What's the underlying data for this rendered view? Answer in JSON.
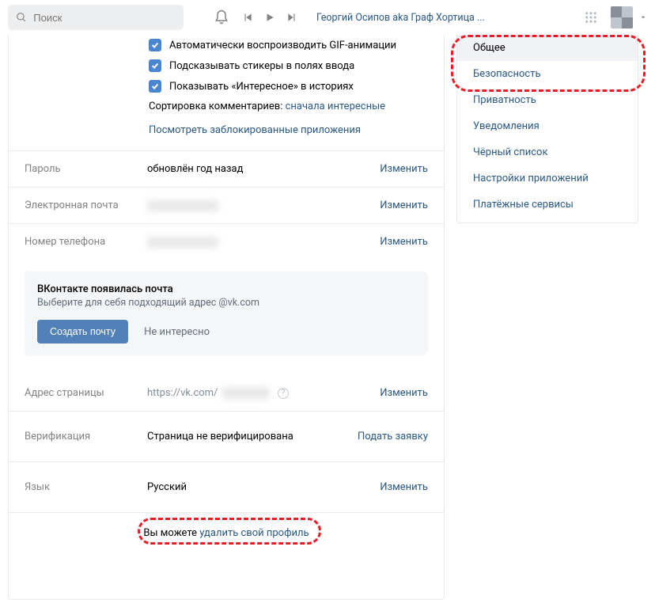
{
  "header": {
    "search_placeholder": "Поиск",
    "track": "Георгий Осипов aka Граф Хортица ..."
  },
  "checkboxes": {
    "gif": "Автоматически воспроизводить GIF-анимации",
    "stickers": "Подсказывать стикеры в полях ввода",
    "interesting": "Показывать «Интересное» в историях"
  },
  "sort_label": "Сортировка комментариев: ",
  "sort_value": "сначала интересные",
  "blocked_apps": "Посмотреть заблокированные приложения",
  "rows": {
    "password_label": "Пароль",
    "password_value": "обновлён год назад",
    "email_label": "Электронная почта",
    "phone_label": "Номер телефона",
    "url_label": "Адрес страницы",
    "url_value": "https://vk.com/",
    "verify_label": "Верификация",
    "verify_value": "Страница не верифицирована",
    "verify_action": "Подать заявку",
    "lang_label": "Язык",
    "lang_value": "Русский",
    "change": "Изменить"
  },
  "promo": {
    "title": "ВКонтакте появилась почта",
    "subtitle": "Выберите для себя подходящий адрес @vk.com",
    "create": "Создать почту",
    "dismiss": "Не интересно"
  },
  "footer": {
    "prefix": "Вы можете ",
    "link": "удалить свой профиль"
  },
  "sidebar": {
    "items": [
      "Общее",
      "Безопасность",
      "Приватность",
      "Уведомления",
      "Чёрный список",
      "Настройки приложений",
      "Платёжные сервисы"
    ]
  }
}
